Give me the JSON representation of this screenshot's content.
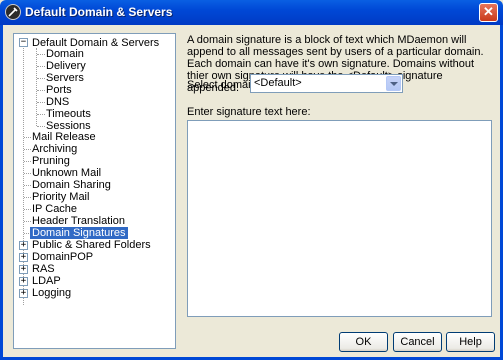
{
  "window": {
    "title": "Default Domain & Servers",
    "close_glyph": "✕"
  },
  "tree": {
    "root_label": "Default Domain & Servers",
    "root_expander": "−",
    "children": [
      "Domain",
      "Delivery",
      "Servers",
      "Ports",
      "DNS",
      "Timeouts",
      "Sessions"
    ],
    "top_items": [
      "Mail Release",
      "Archiving",
      "Pruning",
      "Unknown Mail",
      "Domain Sharing",
      "Priority Mail",
      "IP Cache",
      "Header Translation",
      "Domain Signatures"
    ],
    "selected": "Domain Signatures",
    "collapsed_items": [
      "Public & Shared Folders",
      "DomainPOP",
      "RAS",
      "LDAP",
      "Logging"
    ],
    "collapsed_expander": "+"
  },
  "content": {
    "description": "A domain signature is a block of text which MDaemon will append to all messages sent by users of a particular domain.  Each domain can have it's own signature.  Domains without thier own signature will have the <Default> signature appended.",
    "select_label": "Select domain",
    "select_value": "<Default>",
    "signature_label": "Enter signature text here:",
    "signature_text": ""
  },
  "buttons": {
    "ok": "OK",
    "cancel": "Cancel",
    "help": "Help"
  }
}
